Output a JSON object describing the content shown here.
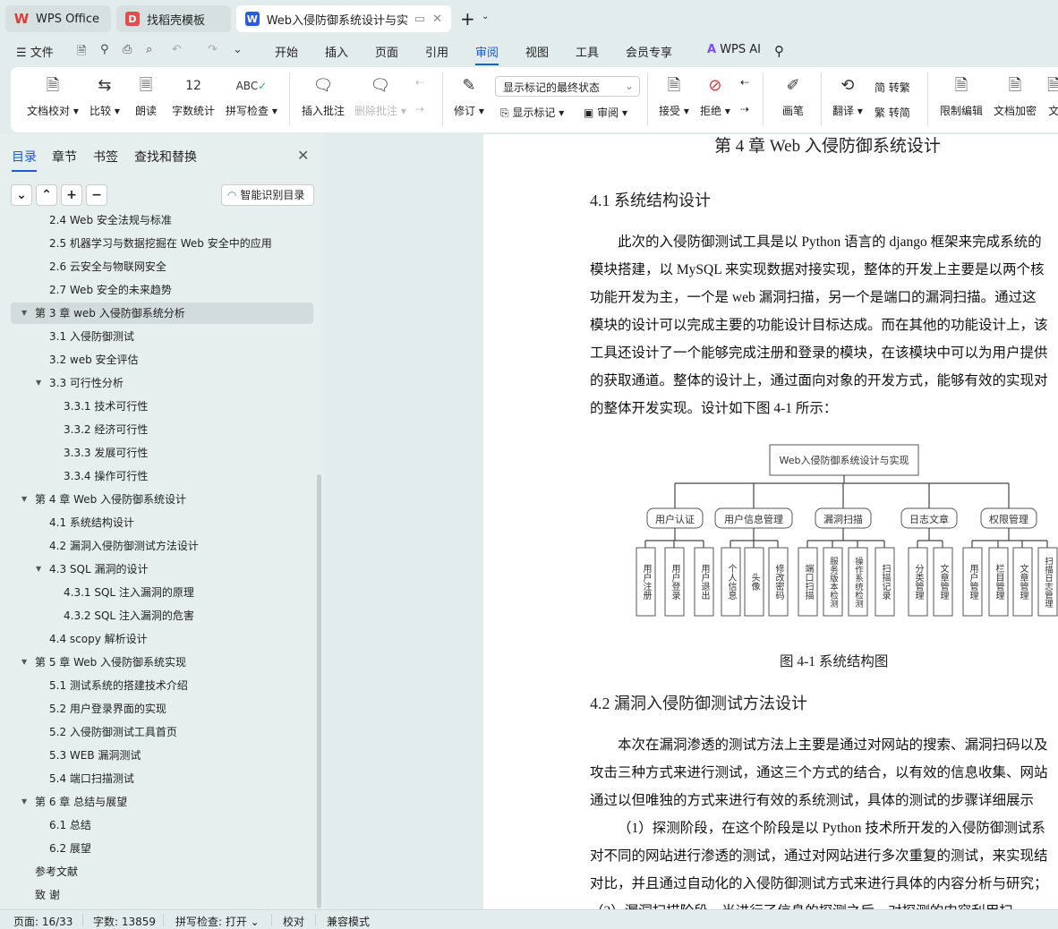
{
  "tabs": [
    {
      "label": "WPS Office",
      "icon": "wps-logo"
    },
    {
      "label": "找稻壳模板",
      "icon": "docer-logo"
    },
    {
      "label": "Web入侵防御系统设计与实现",
      "icon": "writer-logo",
      "active": true
    }
  ],
  "menu": {
    "file": "文件",
    "items": [
      "开始",
      "插入",
      "页面",
      "引用",
      "审阅",
      "视图",
      "工具",
      "会员专享"
    ],
    "active": "审阅",
    "ai": "WPS AI"
  },
  "ribbon": {
    "proofread": "文档校对",
    "compare": "比较",
    "read_aloud": "朗读",
    "word_count": "字数统计",
    "spell_check": "拼写检查",
    "insert_comment": "插入批注",
    "delete_comment": "删除批注",
    "track": "修订",
    "markup_select": "显示标记的最终状态",
    "show_markup": "显示标记",
    "review": "审阅",
    "accept": "接受",
    "reject": "拒绝",
    "pen": "画笔",
    "translate": "翻译",
    "to_trad": "转繁",
    "to_simp": "转简",
    "restrict": "限制编辑",
    "encrypt": "文档加密",
    "more": "文"
  },
  "panel": {
    "tabs": [
      "目录",
      "章节",
      "书签",
      "查找和替换"
    ],
    "active": "目录",
    "smart_toc": "智能识别目录",
    "toc": [
      {
        "label": "2.4 Web 安全法规与标准",
        "level": 2
      },
      {
        "label": "2.5  机器学习与数据挖掘在 Web 安全中的应用",
        "level": 2
      },
      {
        "label": "2.6  云安全与物联网安全",
        "level": 2
      },
      {
        "label": "2.7 Web 安全的未来趋势",
        "level": 2
      },
      {
        "label": "第 3 章  web 入侵防御系统分析",
        "level": 1,
        "expanded": true,
        "selected": true
      },
      {
        "label": "3.1  入侵防御测试",
        "level": 2
      },
      {
        "label": "3.2 web 安全评估",
        "level": 2
      },
      {
        "label": "3.3 可行性分析",
        "level": 2,
        "expanded": true
      },
      {
        "label": "3.3.1 技术可行性",
        "level": 3
      },
      {
        "label": "3.3.2 经济可行性",
        "level": 3
      },
      {
        "label": "3.3.3 发展可行性",
        "level": 3
      },
      {
        "label": "3.3.4 操作可行性",
        "level": 3
      },
      {
        "label": "第 4 章  Web 入侵防御系统设计",
        "level": 1,
        "expanded": true
      },
      {
        "label": "4.1  系统结构设计",
        "level": 2
      },
      {
        "label": "4.2  漏洞入侵防御测试方法设计",
        "level": 2
      },
      {
        "label": "4.3 SQL 漏洞的设计",
        "level": 2,
        "expanded": true
      },
      {
        "label": "4.3.1 SQL 注入漏洞的原理",
        "level": 3
      },
      {
        "label": "4.3.2 SQL 注入漏洞的危害",
        "level": 3
      },
      {
        "label": "4.4 scopy 解析设计",
        "level": 2
      },
      {
        "label": "第 5 章  Web 入侵防御系统实现",
        "level": 1,
        "expanded": true
      },
      {
        "label": "5.1  测试系统的搭建技术介绍",
        "level": 2
      },
      {
        "label": "5.2 用户登录界面的实现",
        "level": 2
      },
      {
        "label": "5.2 入侵防御测试工具首页",
        "level": 2
      },
      {
        "label": "5.3 WEB 漏洞测试",
        "level": 2
      },
      {
        "label": "5.4 端口扫描测试",
        "level": 2
      },
      {
        "label": "第 6 章  总结与展望",
        "level": 1,
        "expanded": true
      },
      {
        "label": "6.1  总结",
        "level": 2
      },
      {
        "label": "6.2  展望",
        "level": 2
      },
      {
        "label": "参考文献",
        "level": 1
      },
      {
        "label": "致    谢",
        "level": 1
      }
    ]
  },
  "doc": {
    "chapter": "第 4 章  Web 入侵防御系统设计",
    "s1": "4.1  系统结构设计",
    "p1": [
      "此次的入侵防御测试工具是以 Python 语言的 django 框架来完成系统的",
      "模块搭建，以 MySQL 来实现数据对接实现，整体的开发上主要是以两个核",
      "功能开发为主，一个是 web 漏洞扫描，另一个是端口的漏洞扫描。通过这",
      "模块的设计可以完成主要的功能设计目标达成。而在其他的功能设计上，该",
      "工具还设计了一个能够完成注册和登录的模块，在该模块中可以为用户提供",
      "的获取通道。整体的设计上，通过面向对象的开发方式，能够有效的实现对",
      "的整体开发实现。设计如下图 4-1 所示："
    ],
    "figure": {
      "root": "Web入侵防御系统设计与实现",
      "groups": [
        {
          "name": "用户认证",
          "children": [
            "用户注册",
            "用户登录",
            "用户退出"
          ]
        },
        {
          "name": "用户信息管理",
          "children": [
            "个人信息",
            "头像",
            "修改密码"
          ]
        },
        {
          "name": "漏洞扫描",
          "children": [
            "端口扫描",
            "服务版本检测",
            "操作系统检测",
            "扫描记录"
          ]
        },
        {
          "name": "日志文章",
          "children": [
            "分类管理",
            "文章管理"
          ]
        },
        {
          "name": "权限管理",
          "children": [
            "用户管理",
            "栏目管理",
            "文章管理",
            "扫描日志管理"
          ]
        }
      ]
    },
    "caption": "图 4-1  系统结构图",
    "s2": "4.2  漏洞入侵防御测试方法设计",
    "p2": [
      "本次在漏洞渗透的测试方法上主要是通过对网站的搜索、漏洞扫码以及",
      "攻击三种方式来进行测试，通这三个方式的结合，以有效的信息收集、网站",
      "通过以但唯独的方式来进行有效的系统测试，具体的测试的步骤详细展示",
      "（1）探测阶段，在这个阶段是以 Python 技术所开发的入侵防御测试系",
      "对不同的网站进行渗透的测试，通过对网站进行多次重复的测试，来实现结",
      "对比，并且通过自动化的入侵防御测试方式来进行具体的内容分析与研究；",
      "（2）漏洞扫描阶段，当进行了信息的探测之后，对探测的内容利用扫"
    ]
  },
  "status": {
    "page": "页面: 16/33",
    "words": "字数: 13859",
    "spell": "拼写检查: 打开",
    "proof": "校对",
    "compat": "兼容模式"
  }
}
